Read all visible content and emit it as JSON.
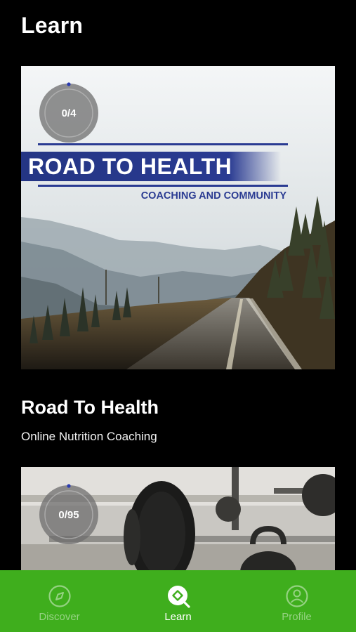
{
  "header": {
    "title": "Learn"
  },
  "cards": [
    {
      "title": "Road To Health",
      "subtitle": "Online Nutrition Coaching",
      "progress_label": "0/4",
      "progress_fraction": 0,
      "image": {
        "banner_title": "ROAD TO HEALTH",
        "banner_subtitle": "COACHING AND COMMUNITY"
      }
    },
    {
      "progress_label": "0/95",
      "progress_fraction": 0
    }
  ],
  "nav": {
    "items": [
      {
        "label": "Discover",
        "icon": "compass-icon",
        "active": false
      },
      {
        "label": "Learn",
        "icon": "learn-search-icon",
        "active": true
      },
      {
        "label": "Profile",
        "icon": "profile-icon",
        "active": false
      }
    ]
  },
  "colors": {
    "nav_bg": "#3fae1d",
    "banner_blue": "#2a3b92"
  }
}
